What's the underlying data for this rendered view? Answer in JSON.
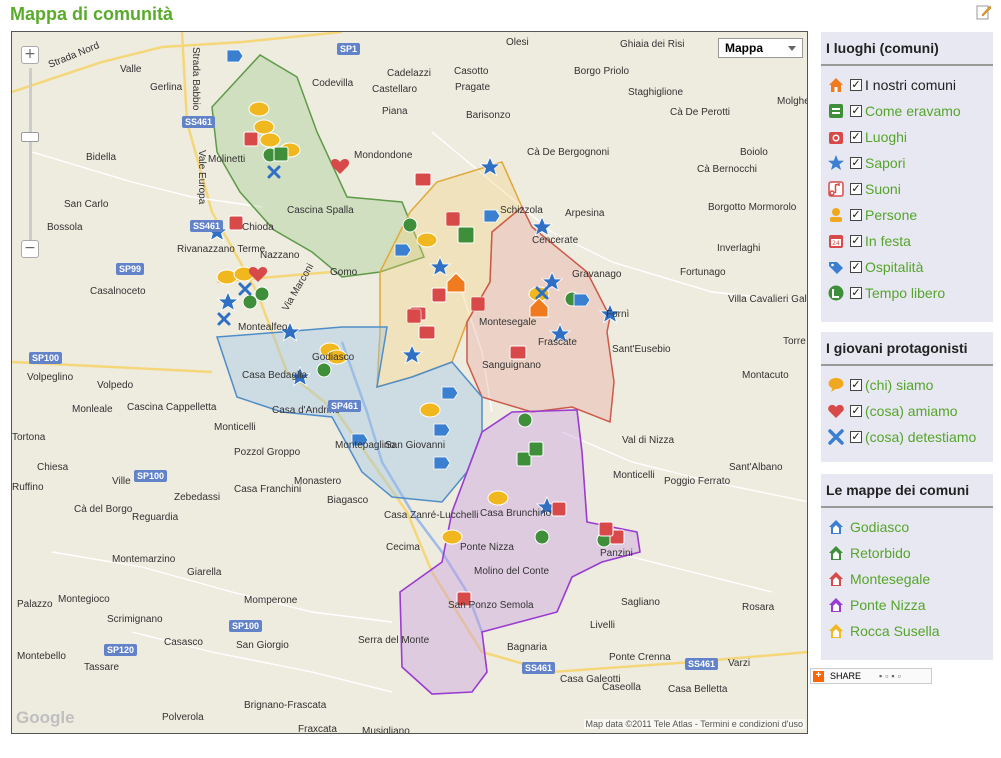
{
  "page": {
    "title": "Mappa di comunità"
  },
  "map": {
    "maptype_label": "Mappa",
    "logo": "Google",
    "attribution": "Map data ©2011 Tele Atlas - Termini e condizioni d'uso",
    "zoom_in": "+",
    "zoom_out": "−",
    "places": [
      "Olesi",
      "Ghiaia dei Risi",
      "Borgo Priolo",
      "Valle",
      "Gerlina",
      "Codevilla",
      "Cadelazzi",
      "Casotto",
      "Castellaro",
      "Pragate",
      "Staghiglione",
      "Molghe",
      "Piana",
      "Barisonzo",
      "Cà De Perotti",
      "Molinetti",
      "Bidella",
      "Mondondone",
      "Cà De Bergognoni",
      "Boiolo",
      "Cà Bernocchi",
      "San Carlo",
      "Bossola",
      "Cascina Spalla",
      "Schizzola",
      "Arpesina",
      "Borgotto Mormorolo",
      "Chioda",
      "Cencerate",
      "Inverlaghi",
      "Rivanazzano Terme",
      "Nazzano",
      "Gomo",
      "Gravanago",
      "Fortunago",
      "Casalnoceto",
      "Montesegale",
      "Fornì",
      "Villa Cavalieri Galeazzi",
      "Montealfeo",
      "Frascate",
      "Sant'Eusebio",
      "Torre Alb",
      "Volpeglino",
      "Sanguignano",
      "Montacuto",
      "Casa Bedaglia",
      "Godiasco",
      "Volpedo",
      "Monleale",
      "Cascina Cappelletta",
      "Casa d'Andrino",
      "Montepaglino",
      "Monticelli",
      "Pozzol Groppo",
      "San Giovanni",
      "Val di Nizza",
      "Tortona",
      "Chiesa",
      "Ville",
      "Monastero",
      "Monticelli",
      "Poggio Ferrato",
      "Sant'Albano",
      "Ruffino",
      "Cà del Borgo",
      "Zebedassi",
      "Casa Franchini",
      "Biagasco",
      "Casa Zanré-Lucchelli",
      "Casa Brunchino",
      "Ponte Nizza",
      "Panzini",
      "Reguardia",
      "Montemarzino",
      "Giarella",
      "Cecima",
      "Molino del Conte",
      "Palazzo",
      "Montegioco",
      "Momperone",
      "San Ponzo Semola",
      "Scrimignano",
      "Sagliano",
      "Rosara",
      "Livelli",
      "Casasco",
      "San Giorgio",
      "Serra del Monte",
      "Montebello",
      "Tassare",
      "Bagnaria",
      "Ponte Crenna",
      "Varzi",
      "Casa Galeotti",
      "Caseolla",
      "Casa Belletta",
      "Brignano-Frascata",
      "Polverola",
      "Fraxcata",
      "Musigliano",
      "Strada Babbio",
      "Strada Nord",
      "Vale Europa",
      "Via Marconi",
      "Marconi"
    ],
    "roads": [
      "SP1",
      "SS461",
      "SS461",
      "SP99",
      "SP100",
      "SP461",
      "SP100",
      "SP100",
      "SP120",
      "SS461",
      "SS461"
    ]
  },
  "sidebar": {
    "luoghi": {
      "title": "I luoghi (comuni)",
      "items": [
        {
          "label": "I nostri comuni",
          "icon": "house-icon",
          "color": "#f07a1e",
          "checked": "☑",
          "dark": true
        },
        {
          "label": "Come eravamo",
          "icon": "archive-icon",
          "color": "#3f8f3a",
          "checked": "☑"
        },
        {
          "label": "Luoghi",
          "icon": "camera-icon",
          "color": "#d84a4a",
          "checked": "☑"
        },
        {
          "label": "Sapori",
          "icon": "star-icon",
          "color": "#3a7fd0",
          "checked": "☑"
        },
        {
          "label": "Suoni",
          "icon": "music-note-icon",
          "color": "#d84a4a",
          "checked": "☑"
        },
        {
          "label": "Persone",
          "icon": "person-icon",
          "color": "#f0a81e",
          "checked": "☑"
        },
        {
          "label": "In festa",
          "icon": "calendar-icon",
          "color": "#d84a4a",
          "checked": "☑"
        },
        {
          "label": "Ospitalità",
          "icon": "tag-icon",
          "color": "#3a7fd0",
          "checked": "☑"
        },
        {
          "label": "Tempo libero",
          "icon": "leisure-icon",
          "color": "#3f8f3a",
          "checked": "☑"
        }
      ]
    },
    "giovani": {
      "title": "I giovani protagonisti",
      "items": [
        {
          "label": "(chi) siamo",
          "icon": "speech-bubble-icon",
          "color": "#f0a81e",
          "checked": "☑"
        },
        {
          "label": "(cosa) amiamo",
          "icon": "heart-icon",
          "color": "#d84a4a",
          "checked": "☑"
        },
        {
          "label": "(cosa) detestiamo",
          "icon": "cross-icon",
          "color": "#3a7fd0",
          "checked": "☑"
        }
      ]
    },
    "mappe": {
      "title": "Le mappe dei comuni",
      "items": [
        {
          "label": "Godiasco",
          "color": "#3a7fd0"
        },
        {
          "label": "Retorbido",
          "color": "#3f8f3a"
        },
        {
          "label": "Montesegale",
          "color": "#d84a4a"
        },
        {
          "label": "Ponte Nizza",
          "color": "#9a3ccf"
        },
        {
          "label": "Rocca Susella",
          "color": "#f0b81e"
        }
      ]
    },
    "share_label": "SHARE"
  }
}
